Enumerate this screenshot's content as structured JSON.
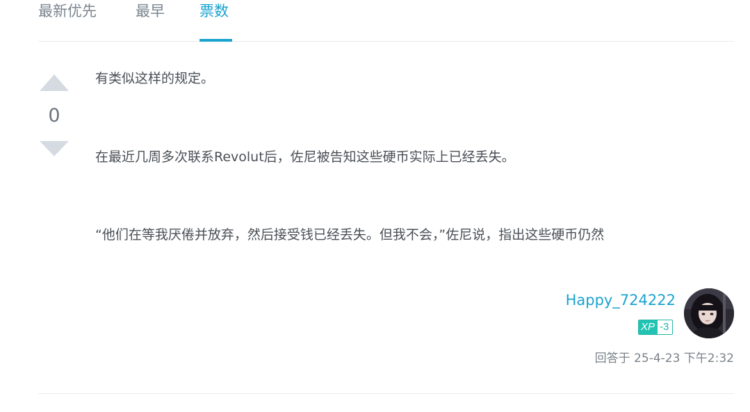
{
  "sort_tabs": {
    "newest": "最新优先",
    "oldest": "最早",
    "votes": "票数",
    "active": "票数"
  },
  "vote": {
    "count": "0"
  },
  "answer": {
    "paragraphs": [
      "有类似这样的规定。",
      "在最近几周多次联系Revolut后，佐尼被告知这些硬币实际上已经丢失。",
      "“他们在等我厌倦并放弃，然后接受钱已经丢失。但我不会，”佐尼说，指出这些硬币仍然"
    ]
  },
  "author": {
    "username": "Happy_724222",
    "xp_label": "XP",
    "xp_value": "-3",
    "avatar_icon": "user-avatar-photo"
  },
  "meta": {
    "answered_at": "回答于 25-4-23 下午2:32"
  },
  "colors": {
    "accent": "#1aa3cf",
    "xp": "#22c3b3",
    "vote_arrow": "#d5dbe1"
  }
}
